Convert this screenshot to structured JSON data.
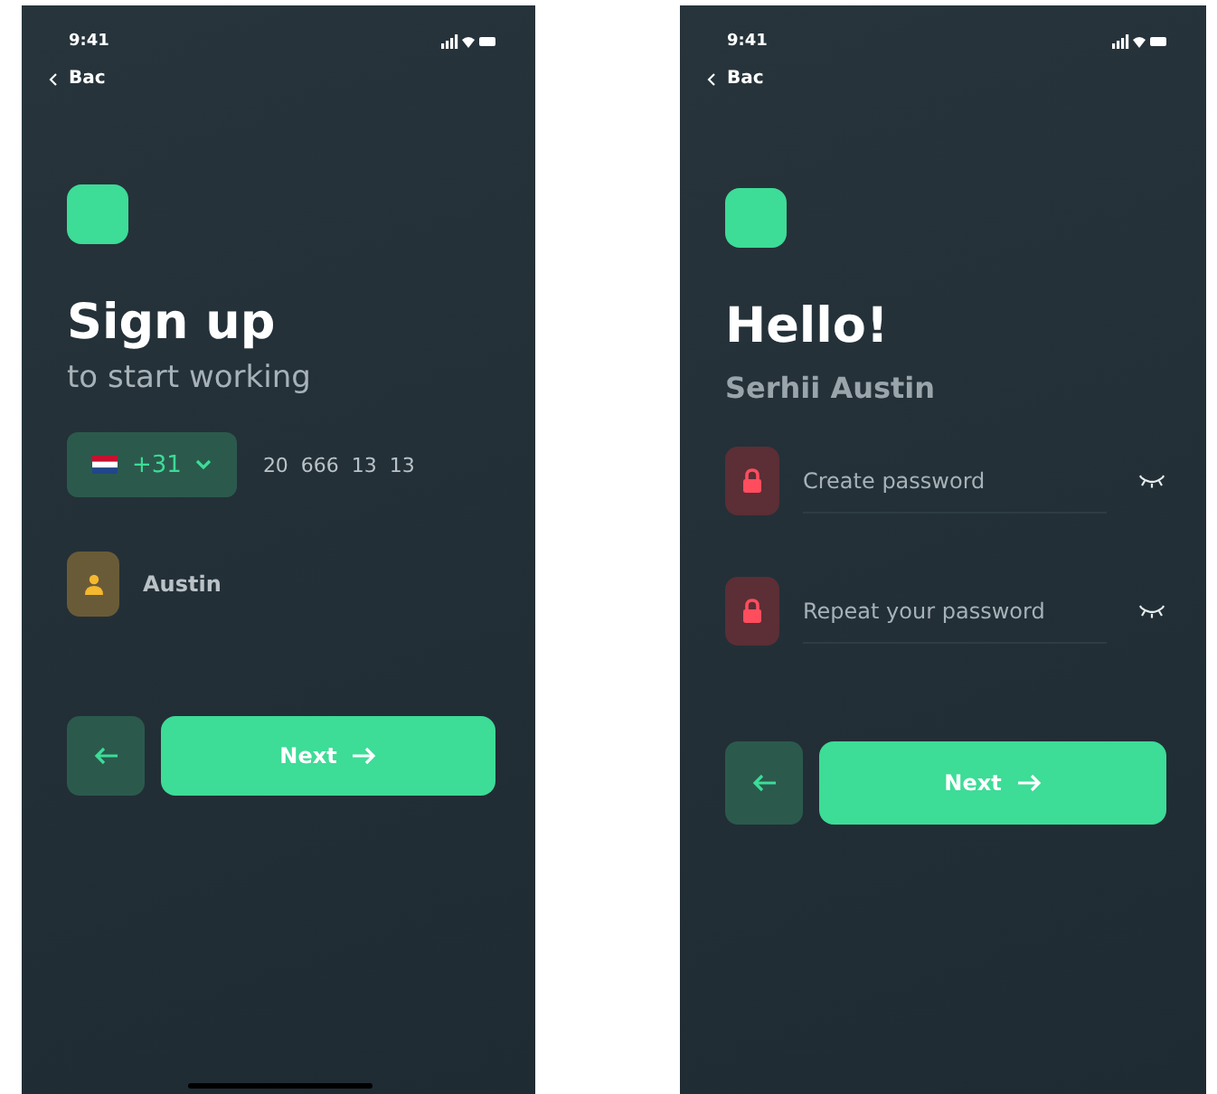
{
  "screens": [
    {
      "kind": "signup",
      "status_time": "9:41",
      "back_label": "Bac",
      "title": "Sign up",
      "subtitle": "to start working",
      "fields": [
        {
          "kind": "phone",
          "country_code": "+31",
          "value": "20  666  13  13"
        },
        {
          "kind": "name",
          "value": "Austin"
        }
      ],
      "next_label": "Next",
      "home_indicator": true
    },
    {
      "kind": "hello",
      "status_time": "9:41",
      "back_label": "Bac",
      "title": "Hello!",
      "subtitle": "Serhii Austin",
      "fields": [
        {
          "kind": "password",
          "placeholder": "Create password"
        },
        {
          "kind": "password",
          "placeholder": "Repeat your password"
        }
      ],
      "next_label": "Next",
      "home_indicator": false
    }
  ]
}
